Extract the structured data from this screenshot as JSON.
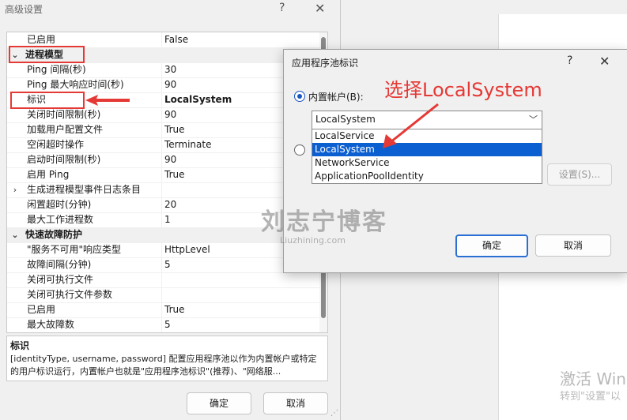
{
  "background_window": {
    "activation_line1": "激活 Win",
    "activation_line2": "转到\"设置\"以"
  },
  "advanced_dialog": {
    "title": "高级设置",
    "help_glyph": "?",
    "close_glyph": "✕",
    "rows": [
      {
        "name": "已启用",
        "value": "False"
      },
      {
        "name": "进程模型",
        "value": "",
        "category": true
      },
      {
        "name": "Ping 间隔(秒)",
        "value": "30"
      },
      {
        "name": "Ping 最大响应时间(秒)",
        "value": "90"
      },
      {
        "name": "标识",
        "value": "LocalSystem"
      },
      {
        "name": "关闭时间限制(秒)",
        "value": "90"
      },
      {
        "name": "加载用户配置文件",
        "value": "True"
      },
      {
        "name": "空闲超时操作",
        "value": "Terminate"
      },
      {
        "name": "启动时间限制(秒)",
        "value": "90"
      },
      {
        "name": "启用 Ping",
        "value": "True"
      },
      {
        "name": "生成进程模型事件日志条目",
        "value": ""
      },
      {
        "name": "闲置超时(分钟)",
        "value": "20"
      },
      {
        "name": "最大工作进程数",
        "value": "1"
      },
      {
        "name": "快速故障防护",
        "value": "",
        "category": true
      },
      {
        "name": "\"服务不可用\"响应类型",
        "value": "HttpLevel"
      },
      {
        "name": "故障间隔(分钟)",
        "value": "5"
      },
      {
        "name": "关闭可执行文件",
        "value": ""
      },
      {
        "name": "关闭可执行文件参数",
        "value": ""
      },
      {
        "name": "已启用",
        "value": "True"
      },
      {
        "name": "最大故障数",
        "value": "5"
      }
    ],
    "description_title": "标识",
    "description_text": "[identityType, username, password] 配置应用程序池以作为内置帐户或特定的用户标识运行，内置帐户也就是\"应用程序池标识\"(推荐)、\"网络服...",
    "ok_label": "确定",
    "cancel_label": "取消"
  },
  "pool_dialog": {
    "title": "应用程序池标识",
    "help_glyph": "?",
    "close_glyph": "✕",
    "builtin_label": "内置帐户(B):",
    "combo_value": "LocalSystem",
    "options": [
      "LocalService",
      "LocalSystem",
      "NetworkService",
      "ApplicationPoolIdentity"
    ],
    "selected_option": "LocalSystem",
    "set_button": "设置(S)...",
    "ok_label": "确定",
    "cancel_label": "取消"
  },
  "annotation": {
    "text": "选择LocalSystem",
    "color": "#e53935"
  },
  "watermark": {
    "line1": "刘志宁博客",
    "line2": "Liuzhining.com"
  }
}
